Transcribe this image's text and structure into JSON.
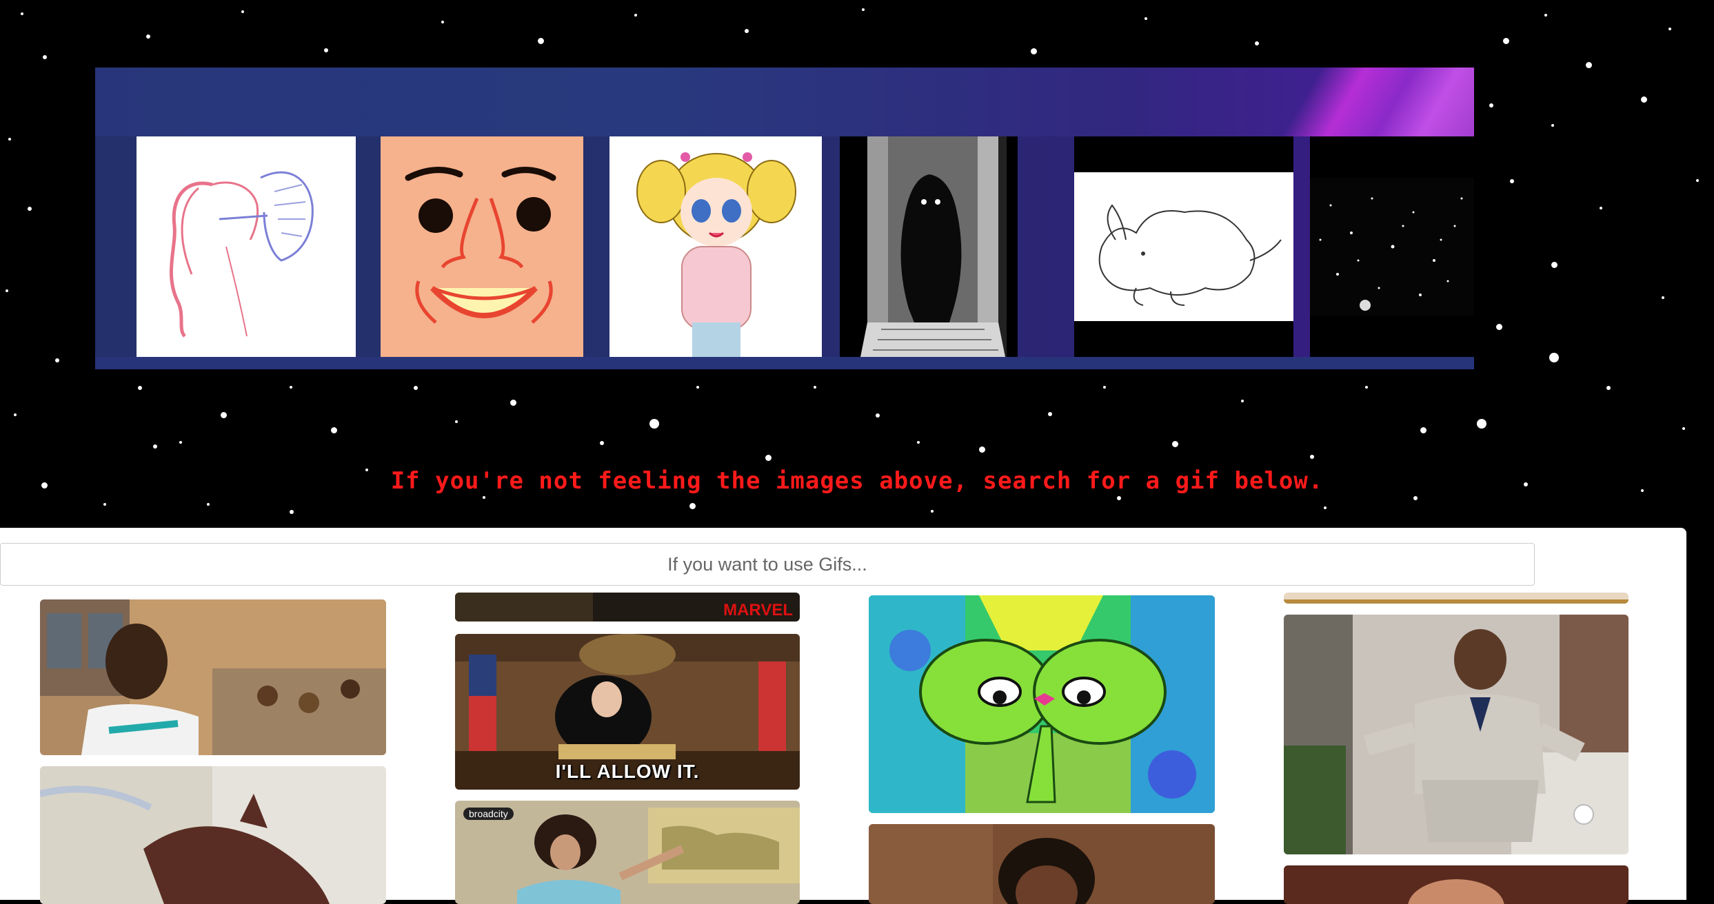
{
  "hint_text": "If you're not feeling the images above, search for a gif below.",
  "search": {
    "placeholder": "If you want to use Gifs..."
  },
  "gallery": {
    "tiles": [
      {
        "icon": "girl-eating-shoe-illustration"
      },
      {
        "icon": "cartoon-face-illustration"
      },
      {
        "icon": "anime-girl-illustration"
      },
      {
        "icon": "shadow-creature-manga-illustration"
      },
      {
        "icon": "animal-sketch-illustration"
      },
      {
        "icon": "starfield-photo"
      }
    ]
  },
  "gifs": {
    "judge_caption": "I'LL ALLOW IT.",
    "marvel_tag": "MARVEL",
    "channel_tag": "broadcity"
  },
  "colors": {
    "hint": "#ff1a1a",
    "banner": "#25306e",
    "panel": "#ffffff"
  }
}
